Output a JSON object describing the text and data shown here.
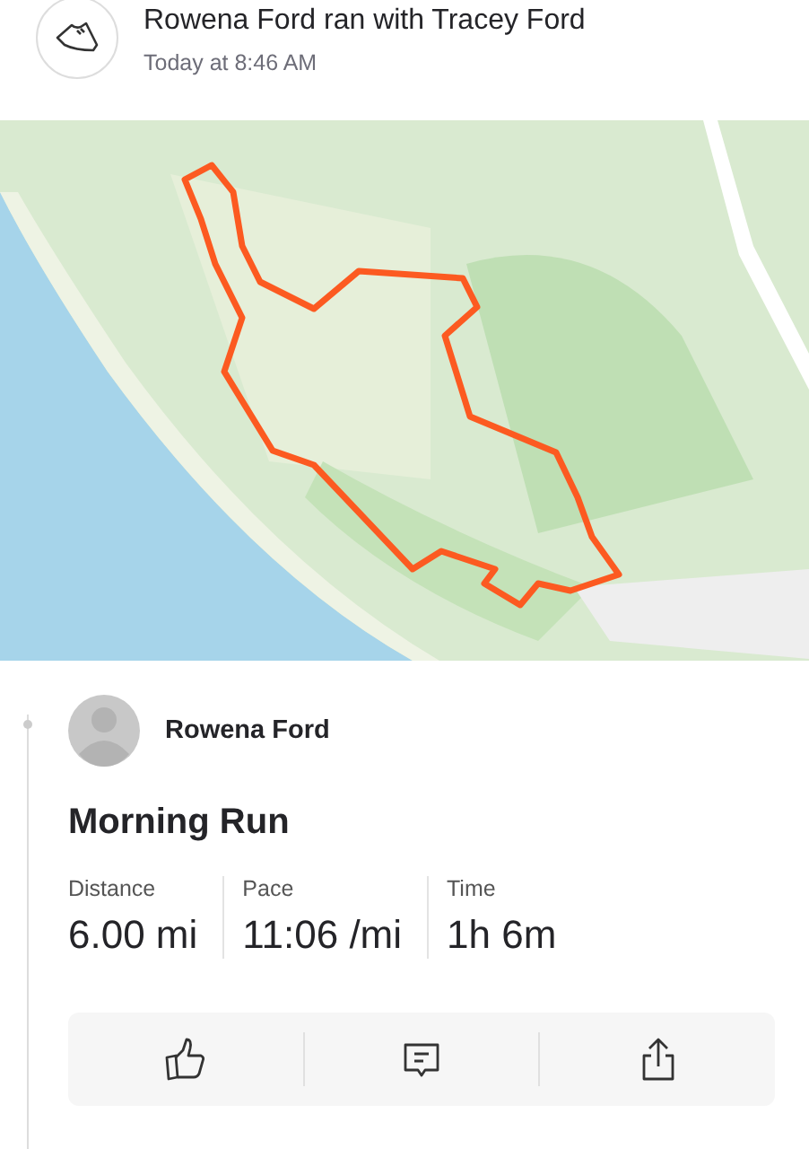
{
  "header": {
    "title": "Rowena Ford ran with Tracey Ford",
    "time": "Today at 8:46 AM"
  },
  "athlete": {
    "name": "Rowena Ford"
  },
  "activity": {
    "title": "Morning Run"
  },
  "stats": [
    {
      "label": "Distance",
      "value": "6.00 mi"
    },
    {
      "label": "Pace",
      "value": "11:06 /mi"
    },
    {
      "label": "Time",
      "value": "1h 6m"
    }
  ],
  "actions": [
    {
      "kind": "kudos"
    },
    {
      "kind": "comment"
    },
    {
      "kind": "share"
    }
  ]
}
